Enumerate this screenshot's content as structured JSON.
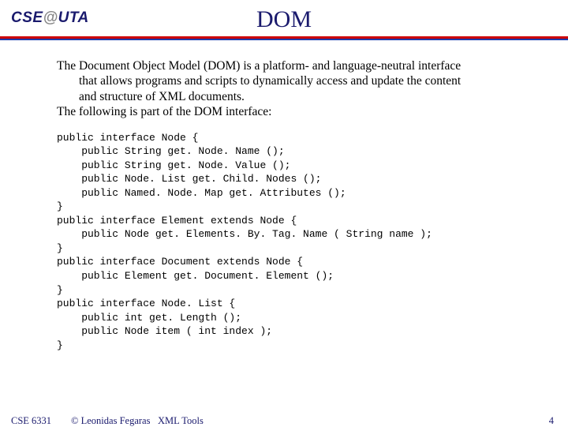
{
  "header": {
    "logo_prefix": "CSE",
    "logo_at": "@",
    "logo_suffix": "UTA",
    "title": "DOM"
  },
  "intro": {
    "p1a": "The Document Object Model (DOM) is a platform- and language-neutral interface",
    "p1b": "that allows programs and scripts to dynamically access and update the content",
    "p1c": "and structure of XML documents.",
    "p2": "The following is part of the DOM interface:"
  },
  "code": "public interface Node {\n    public String get. Node. Name ();\n    public String get. Node. Value ();\n    public Node. List get. Child. Nodes ();\n    public Named. Node. Map get. Attributes ();\n}\npublic interface Element extends Node {\n    public Node get. Elements. By. Tag. Name ( String name );\n}\npublic interface Document extends Node {\n    public Element get. Document. Element ();\n}\npublic interface Node. List {\n    public int get. Length ();\n    public Node item ( int index );\n}",
  "footer": {
    "course": "CSE 6331",
    "copyright": "© Leonidas Fegaras",
    "section": "XML Tools",
    "page": "4"
  }
}
